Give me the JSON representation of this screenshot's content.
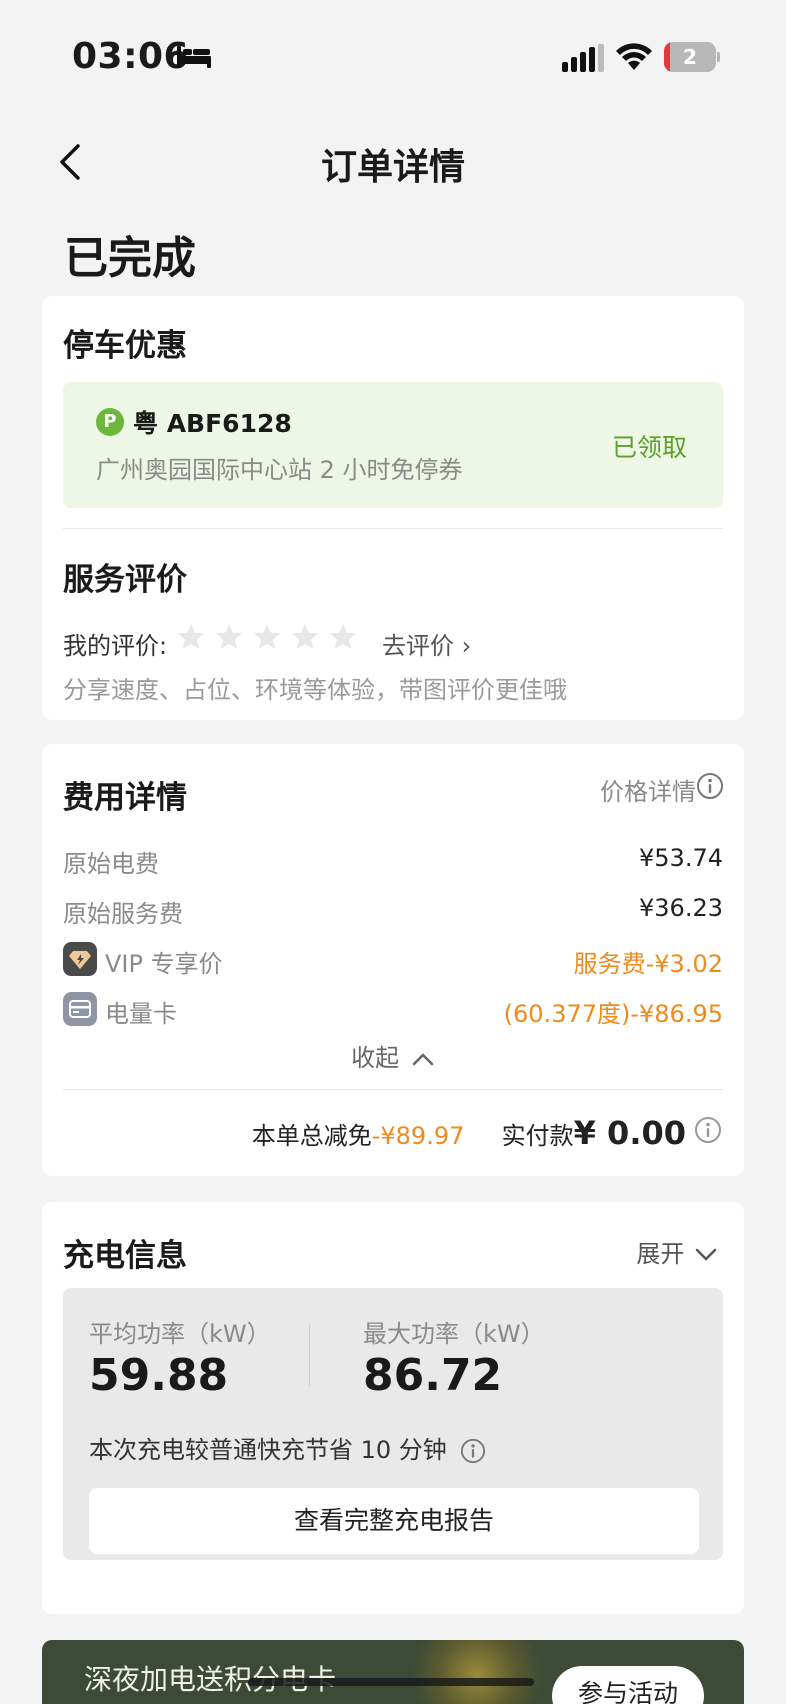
{
  "status_bar": {
    "time": "03:06",
    "battery": "2"
  },
  "nav": {
    "title": "订单详情"
  },
  "order_status": "已完成",
  "parking": {
    "title": "停车优惠",
    "badge": "P",
    "plate": "粤 ABF6128",
    "description": "广州奥园国际中心站 2 小时免停券",
    "status": "已领取"
  },
  "rating": {
    "title": "服务评价",
    "label": "我的评价:",
    "stars": 5,
    "action": "去评价 ›",
    "hint": "分享速度、占位、环境等体验，带图评价更佳哦"
  },
  "fees": {
    "title": "费用详情",
    "price_detail": "价格详情",
    "items": [
      {
        "label": "原始电费",
        "value": "¥53.74"
      },
      {
        "label": "原始服务费",
        "value": "¥36.23"
      },
      {
        "label": "VIP 专享价",
        "value": "服务费-¥3.02",
        "icon": "vip-diamond-icon"
      },
      {
        "label": "电量卡",
        "value": "(60.377度)-¥86.95",
        "icon": "card-icon"
      }
    ],
    "collapse": "收起",
    "total_discount_label": "本单总减免",
    "total_discount": "-¥89.97",
    "paid_label": "实付款",
    "paid_amount": "¥ 0.00"
  },
  "charging": {
    "title": "充电信息",
    "expand": "展开",
    "avg_power_label": "平均功率（kW）",
    "avg_power": "59.88",
    "max_power_label": "最大功率（kW）",
    "max_power": "86.72",
    "saving": "本次充电较普通快充节省 10 分钟",
    "report_button": "查看完整充电报告"
  },
  "banner": {
    "text": "深夜加电送积分电卡",
    "button": "参与活动"
  },
  "colors": {
    "accent_green": "#5ca02c",
    "accent_orange": "#f08a1a",
    "coupon_bg": "#eef6e6"
  }
}
